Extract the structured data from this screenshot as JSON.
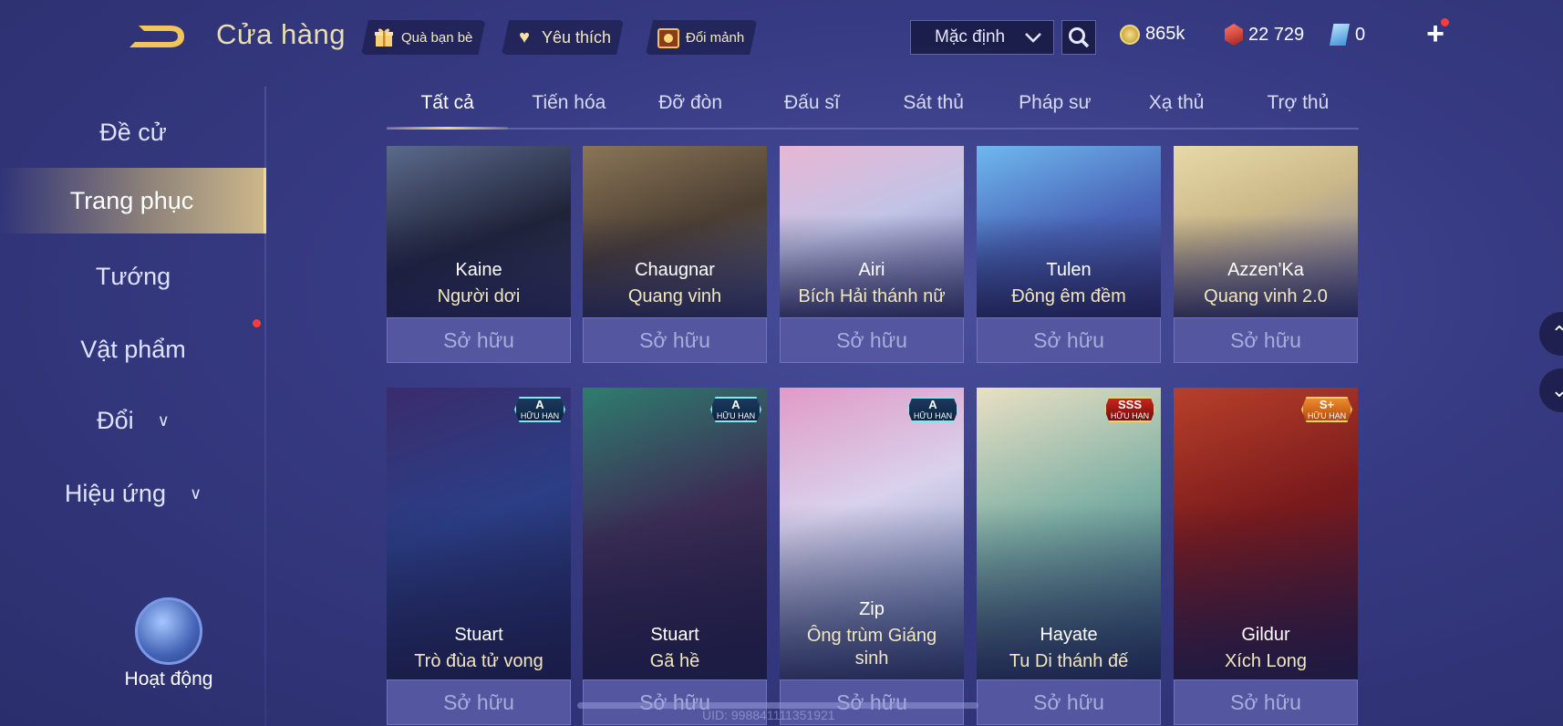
{
  "header": {
    "title": "Cửa hàng",
    "friend_gift": "Quà bạn bè",
    "favorites": "Yêu thích",
    "exchange_shards": "Đổi mảnh",
    "sort_selected": "Mặc định",
    "gold": "865k",
    "vouchers": "22 729",
    "quan_huy": "0"
  },
  "sidebar": {
    "items": [
      {
        "label": "Đề cử"
      },
      {
        "label": "Trang phục"
      },
      {
        "label": "Tướng"
      },
      {
        "label": "Vật phẩm"
      },
      {
        "label": "Đổi"
      },
      {
        "label": "Hiệu ứng"
      }
    ],
    "activity_label": "Hoạt động"
  },
  "tabs": [
    "Tất cả",
    "Tiến hóa",
    "Đỡ đòn",
    "Đấu sĩ",
    "Sát thủ",
    "Pháp sư",
    "Xạ thủ",
    "Trợ thủ"
  ],
  "status_owned": "Sở hữu",
  "row1": [
    {
      "hero": "Kaine",
      "skin": "Người dơi",
      "status": "Sở hữu"
    },
    {
      "hero": "Chaugnar",
      "skin": "Quang vinh",
      "status": "Sở hữu"
    },
    {
      "hero": "Airi",
      "skin": "Bích Hải thánh nữ",
      "status": "Sở hữu"
    },
    {
      "hero": "Tulen",
      "skin": "Đông êm đềm",
      "status": "Sở hữu"
    },
    {
      "hero": "Azzen'Ka",
      "skin": "Quang vinh 2.0",
      "status": "Sở hữu"
    }
  ],
  "row2": [
    {
      "hero": "Stuart",
      "skin": "Trò đùa tử vong",
      "badge_tier": "A",
      "badge_text": "HỮU HẠN",
      "status": "Sở hữu"
    },
    {
      "hero": "Stuart",
      "skin": "Gã hề",
      "badge_tier": "A",
      "badge_text": "HỮU HẠN",
      "status": "Sở hữu"
    },
    {
      "hero": "Zip",
      "skin": "Ông trùm Giáng sinh",
      "badge_tier": "A",
      "badge_text": "HỮU HẠN",
      "status": "Sở hữu"
    },
    {
      "hero": "Hayate",
      "skin": "Tu Di thánh đế",
      "badge_tier": "SSS",
      "badge_text": "HỮU HẠN",
      "status": "Sở hữu"
    },
    {
      "hero": "Gildur",
      "skin": "Xích Long",
      "badge_tier": "S+",
      "badge_text": "HỮU HẠN",
      "status": "Sở hữu"
    }
  ],
  "uid": "UID: 998841111351921",
  "colors": {
    "accent_gold": "#f0d68a",
    "background": "#363a82",
    "owned_bar": "#5457a0",
    "red_dot": "#ff3b3b"
  },
  "icons": [
    "back-logo-icon",
    "gift-icon",
    "heart-icon",
    "shard-chest-icon",
    "chevron-down-icon",
    "search-icon",
    "gold-coin-icon",
    "voucher-gem-icon",
    "quan-huy-icon",
    "plus-icon",
    "scroll-up-icon",
    "scroll-down-icon"
  ]
}
